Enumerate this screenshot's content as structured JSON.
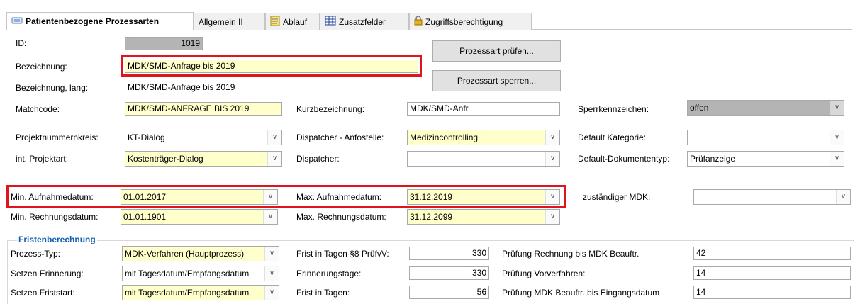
{
  "tabs": [
    {
      "label": "Patientenbezogene Prozessarten",
      "icon": "window-icon"
    },
    {
      "label": "Allgemein II",
      "icon": ""
    },
    {
      "label": "Ablauf",
      "icon": "notepad-icon"
    },
    {
      "label": "Zusatzfelder",
      "icon": "grid-icon"
    },
    {
      "label": "Zugriffsberechtigung",
      "icon": "lock-icon"
    }
  ],
  "form": {
    "id_label": "ID:",
    "id_value": "1019",
    "bez_label": "Bezeichnung:",
    "bez_value": "MDK/SMD-Anfrage bis 2019",
    "bezlang_label": "Bezeichnung, lang:",
    "bezlang_value": "MDK/SMD-Anfrage bis 2019",
    "matchcode_label": "Matchcode:",
    "matchcode_value": "MDK/SMD-ANFRAGE BIS 2019",
    "kurzbez_label": "Kurzbezeichnung:",
    "kurzbez_value": "MDK/SMD-Anfr",
    "sperr_label": "Sperrkennzeichen:",
    "sperr_value": "offen",
    "projnr_label": "Projektnummernkreis:",
    "projnr_value": "KT-Dialog",
    "dispanf_label": "Dispatcher - Anfostelle:",
    "dispanf_value": "Medizincontrolling",
    "defkat_label": "Default Kategorie:",
    "defkat_value": "",
    "projart_label": "int. Projektart:",
    "projart_value": "Kostenträger-Dialog",
    "disp_label": "Dispatcher:",
    "disp_value": "",
    "defdok_label": "Default-Dokumententyp:",
    "defdok_value": "Prüfanzeige",
    "minauf_label": "Min. Aufnahmedatum:",
    "minauf_value": "01.01.2017",
    "maxauf_label": "Max. Aufnahmedatum:",
    "maxauf_value": "31.12.2019",
    "mdk_label": "zuständiger MDK:",
    "mdk_value": "",
    "minrech_label": "Min. Rechnungsdatum:",
    "minrech_value": "01.01.1901",
    "maxrech_label": "Max. Rechnungsdatum:",
    "maxrech_value": "31.12.2099"
  },
  "buttons": {
    "pruefen": "Prozessart prüfen...",
    "sperren": "Prozessart sperren..."
  },
  "fristen": {
    "title": "Fristenberechnung",
    "typ_label": "Prozess-Typ:",
    "typ_value": "MDK-Verfahren (Hauptprozess)",
    "frist8_label": "Frist in Tagen §8 PrüfvV:",
    "frist8_value": "330",
    "prrech_label": "Prüfung Rechnung bis MDK Beauftr.",
    "prrech_value": "42",
    "erinn_label": "Setzen Erinnerung:",
    "erinn_value": "mit Tagesdatum/Empfangsdatum",
    "erinntage_label": "Erinnerungstage:",
    "erinntage_value": "330",
    "prvor_label": "Prüfung Vorverfahren:",
    "prvor_value": "14",
    "friststart_label": "Setzen Friststart:",
    "friststart_value": "mit Tagesdatum/Empfangsdatum",
    "frist_label": "Frist in Tagen:",
    "frist_value": "56",
    "prmdk_label": "Prüfung MDK Beauftr. bis Eingangsdatum",
    "prmdk_value": "14"
  },
  "colors": {
    "highlight": "#e0141c",
    "required_field": "#ffffcc",
    "readonly_field": "#b4b4b4",
    "group_title": "#1260b0"
  }
}
